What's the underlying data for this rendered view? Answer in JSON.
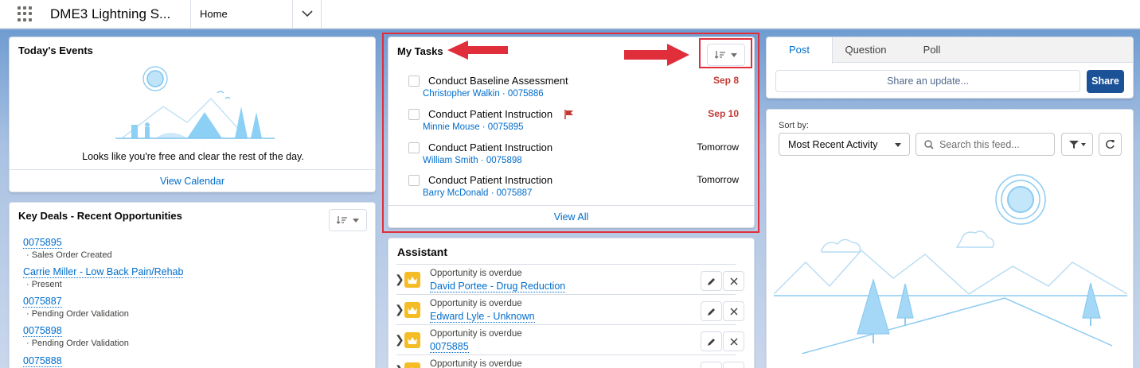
{
  "app": {
    "name": "DME3 Lightning S...",
    "nav_item": "Home"
  },
  "events": {
    "title": "Today's Events",
    "empty_text": "Looks like you're free and clear the rest of the day.",
    "footer_link": "View Calendar"
  },
  "deals": {
    "title": "Key Deals - Recent Opportunities",
    "items": [
      {
        "name": "0075895",
        "detail": "· Sales Order Created"
      },
      {
        "name": "Carrie Miller - Low Back Pain/Rehab",
        "detail": "· Present"
      },
      {
        "name": "0075887",
        "detail": "· Pending Order Validation"
      },
      {
        "name": "0075898",
        "detail": "· Pending Order Validation"
      },
      {
        "name": "0075888",
        "detail": ""
      }
    ]
  },
  "tasks": {
    "title": "My Tasks",
    "items": [
      {
        "name": "Conduct Baseline Assessment",
        "sub": "Christopher Walkin · 0075886",
        "date": "Sep 8",
        "overdue": true,
        "flag": false
      },
      {
        "name": "Conduct Patient Instruction",
        "sub": "Minnie Mouse · 0075895",
        "date": "Sep 10",
        "overdue": true,
        "flag": true
      },
      {
        "name": "Conduct Patient Instruction",
        "sub": "William Smith · 0075898",
        "date": "Tomorrow",
        "overdue": false,
        "flag": false
      },
      {
        "name": "Conduct Patient Instruction",
        "sub": "Barry McDonald · 0075887",
        "date": "Tomorrow",
        "overdue": false,
        "flag": false
      }
    ],
    "footer_link": "View All"
  },
  "assistant": {
    "title": "Assistant",
    "items": [
      {
        "type": "Opportunity is overdue",
        "name": "David Portee - Drug Reduction"
      },
      {
        "type": "Opportunity is overdue",
        "name": "Edward Lyle - Unknown"
      },
      {
        "type": "Opportunity is overdue",
        "name": "0075885"
      },
      {
        "type": "Opportunity is overdue",
        "name": ""
      }
    ]
  },
  "publisher": {
    "tabs": [
      "Post",
      "Question",
      "Poll"
    ],
    "active_tab": "Post",
    "input_placeholder": "Share an update...",
    "share_label": "Share"
  },
  "feed": {
    "sort_label": "Sort by:",
    "sort_value": "Most Recent Activity",
    "search_placeholder": "Search this feed..."
  },
  "colors": {
    "brand": "#0070d2",
    "overdue": "#c23934",
    "highlight": "#e02e3b",
    "share_button": "#1b5297",
    "link": "#006dcc"
  }
}
